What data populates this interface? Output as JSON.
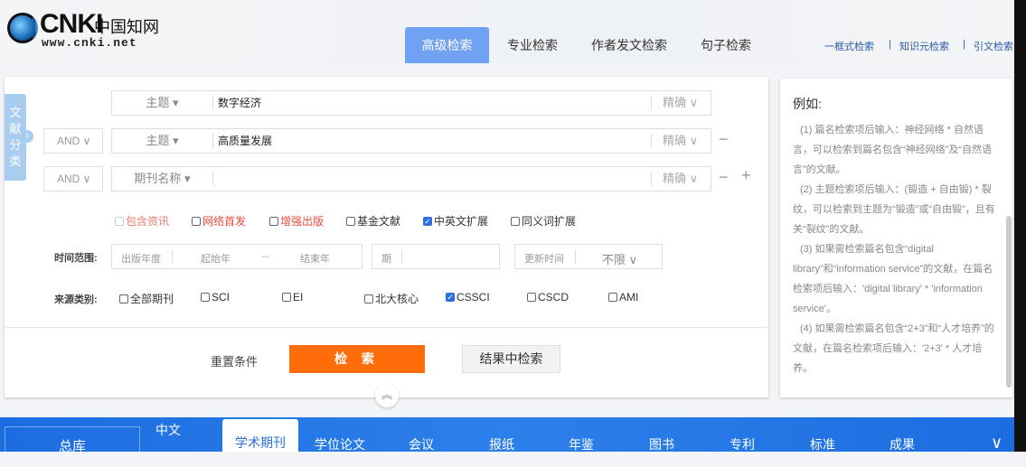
{
  "header": {
    "logo_brand": "CNKI",
    "logo_cn": "中国知网",
    "logo_url": "www.cnki.net",
    "tabs": [
      {
        "label": "高级检索",
        "active": true
      },
      {
        "label": "专业检索"
      },
      {
        "label": "作者发文检索"
      },
      {
        "label": "句子检索"
      }
    ],
    "links": [
      "一框式检索",
      "知识元检索",
      "引文检索"
    ]
  },
  "search": {
    "category_tab": "文献分类",
    "rows": [
      {
        "logic": "",
        "field": "主题",
        "value": "数字经济",
        "mode": "精确"
      },
      {
        "logic": "AND",
        "field": "主题",
        "value": "高质量发展",
        "mode": "精确"
      },
      {
        "logic": "AND",
        "field": "期刊名称",
        "value": "",
        "mode": "精确"
      }
    ],
    "options": [
      {
        "label": "包含资讯",
        "checked": false,
        "disabled": true
      },
      {
        "label": "网络首发",
        "checked": false
      },
      {
        "label": "增强出版",
        "checked": false
      },
      {
        "label": "基金文献",
        "checked": false
      },
      {
        "label": "中英文扩展",
        "checked": true
      },
      {
        "label": "同义词扩展",
        "checked": false
      }
    ],
    "time": {
      "label": "时间范围:",
      "year_type": "出版年度",
      "start_ph": "起始年",
      "dash": "--",
      "end_ph": "结束年",
      "issue": "期",
      "update_label": "更新时间",
      "update_value": "不限"
    },
    "source": {
      "label": "来源类别:",
      "items": [
        {
          "label": "全部期刊",
          "checked": false
        },
        {
          "label": "SCI",
          "checked": false
        },
        {
          "label": "EI",
          "checked": false
        },
        {
          "label": "北大核心",
          "checked": false
        },
        {
          "label": "CSSCI",
          "checked": true
        },
        {
          "label": "CSCD",
          "checked": false
        },
        {
          "label": "AMI",
          "checked": false
        }
      ]
    },
    "reset": "重置条件",
    "search_btn": "检 索",
    "search_in_results": "结果中检索"
  },
  "examples": {
    "title": "例如:",
    "items": [
      "(1) 篇名检索项后输入：神经网络 * 自然语言，可以检索到篇名包含“神经网络”及“自然语言”的文献。",
      "(2) 主题检索项后输入：(锻造 + 自由锻) * 裂纹，可以检索到主题为“锻造”或“自由锻”，且有关“裂纹”的文献。",
      "(3) 如果需检索篇名包含“digital library”和“information service”的文献，在篇名检索项后输入：'digital library' * 'information service'。",
      "(4) 如果需检索篇名包含“2+3”和“人才培养”的文献，在篇名检索项后输入：'2+3' * 人才培养。"
    ]
  },
  "nav": {
    "all": "总库",
    "lang": "中文",
    "items": [
      "学术期刊",
      "学位论文",
      "会议",
      "报纸",
      "年鉴",
      "图书",
      "专利",
      "标准",
      "成果"
    ],
    "active": "学术期刊"
  }
}
